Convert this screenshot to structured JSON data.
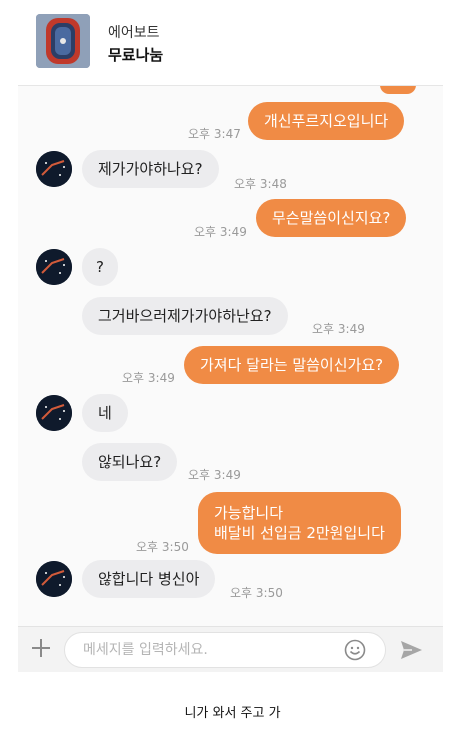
{
  "header": {
    "product_name": "에어보트",
    "status": "무료나눔"
  },
  "messages": [
    {
      "side": "me",
      "text": "",
      "time": "",
      "partial": true
    },
    {
      "side": "me",
      "text": "개신푸르지오입니다",
      "time": "오후 3:47"
    },
    {
      "side": "them",
      "text": "제가가야하나요?",
      "time": "오후 3:48"
    },
    {
      "side": "me",
      "text": "무슨말씀이신지요?",
      "time": "오후 3:49"
    },
    {
      "side": "them",
      "text": "?",
      "time": ""
    },
    {
      "side": "them",
      "text": "그거바으러제가가야하난요?",
      "time": "오후 3:49"
    },
    {
      "side": "me",
      "text": "가져다 달라는 말씀이신가요?",
      "time": "오후 3:49"
    },
    {
      "side": "them",
      "text": "네",
      "time": ""
    },
    {
      "side": "them",
      "text": "않되나요?",
      "time": "오후 3:49"
    },
    {
      "side": "me",
      "text": "가능합니다\n배달비 선입금 2만원입니다",
      "line1": "가능합니다",
      "line2": "배달비 선입금 2만원입니다",
      "time": "오후 3:50"
    },
    {
      "side": "them",
      "text": "않합니다 병신아",
      "time": "오후 3:50"
    }
  ],
  "input": {
    "placeholder": "메세지를 입력하세요."
  },
  "colors": {
    "my_bubble": "#f08b45",
    "their_bubble": "#ececee",
    "time_text": "#9a9a9a"
  },
  "icons": [
    "plus-icon",
    "emoji-icon",
    "send-icon"
  ],
  "caption": "니가 와서 주고 가"
}
